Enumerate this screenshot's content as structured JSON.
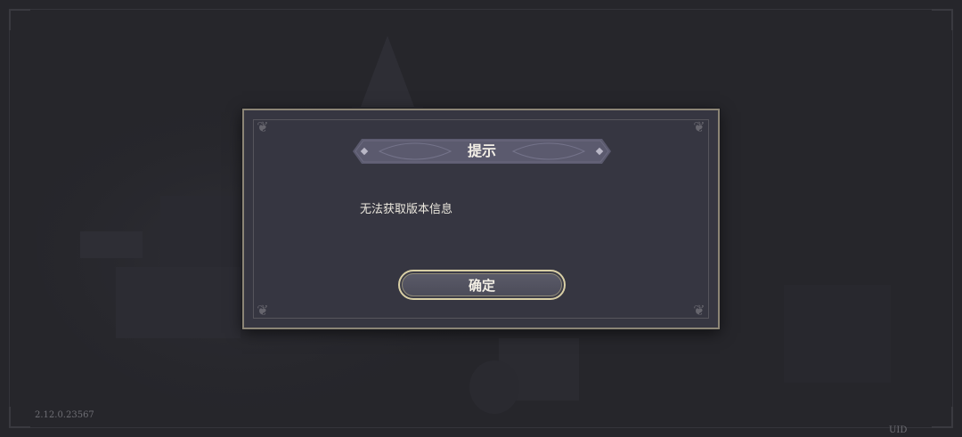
{
  "dialog": {
    "title": "提示",
    "message": "无法获取版本信息",
    "confirm_label": "确定"
  },
  "footer": {
    "version": "2.12.0.23567",
    "uid_label": "UID"
  },
  "colors": {
    "background": "#26262b",
    "dialog_bg": "#363641",
    "dialog_border": "#8c8576",
    "title_banner": "#5b5a6e",
    "button_border": "#d9cfa5",
    "text": "#ece8de"
  },
  "icons": {
    "dialog_corner": "flourish-icon",
    "title_ornament": "diamond-icon"
  }
}
